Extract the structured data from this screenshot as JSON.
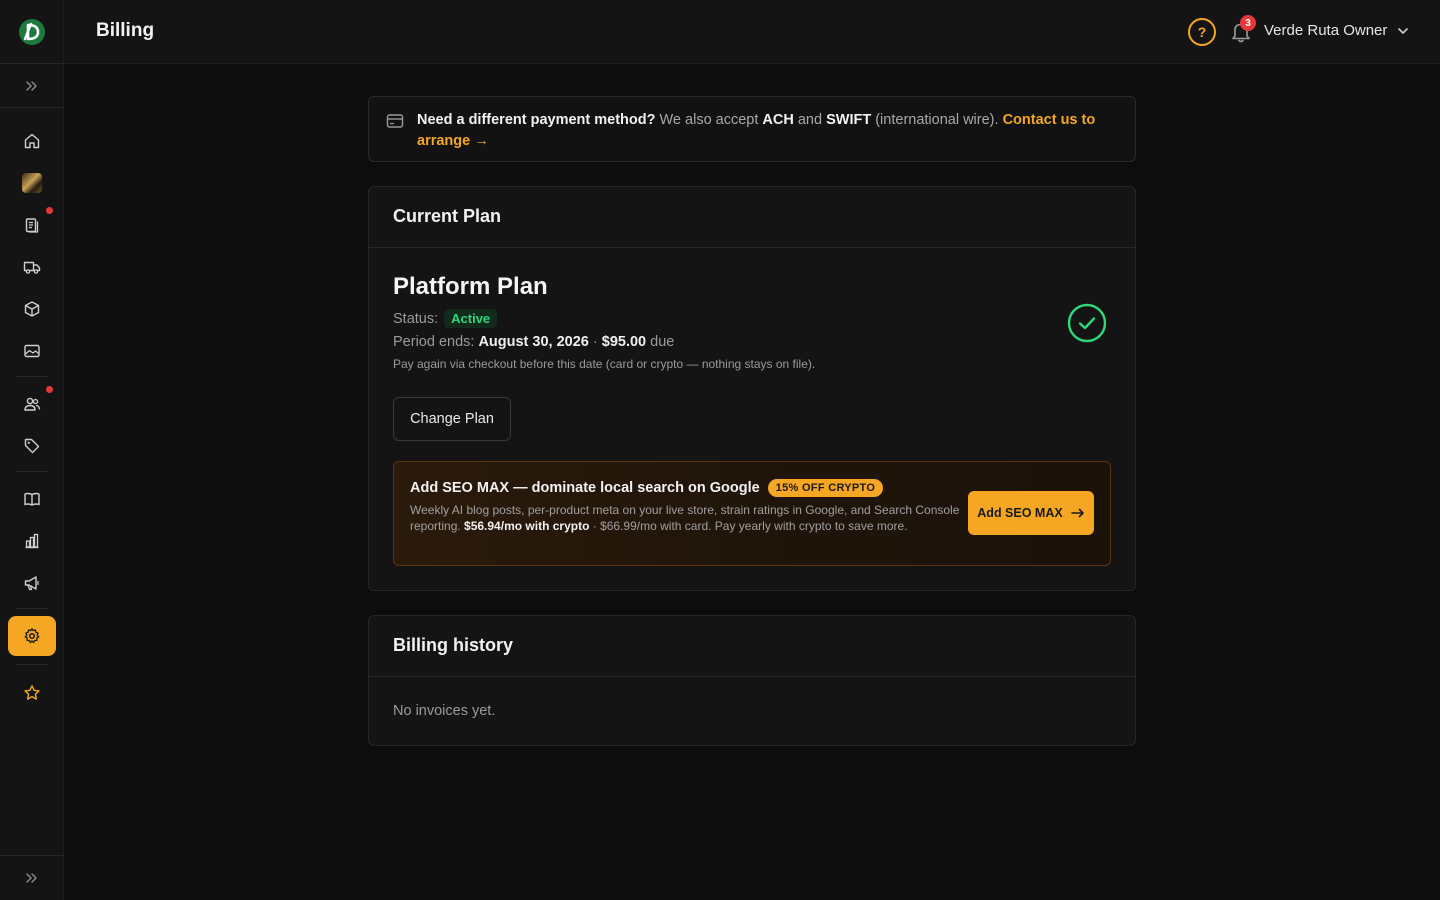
{
  "header": {
    "title": "Billing",
    "notifications_count": "3",
    "user_name": "Verde Ruta Owner"
  },
  "banner": {
    "lead": "Need a different payment method?",
    "text1": " We also accept ",
    "ach": "ACH",
    "and": " and ",
    "swift": "SWIFT",
    "text2": " (international wire).  ",
    "link": "Contact us to arrange →"
  },
  "current_plan": {
    "heading": "Current Plan",
    "plan_name": "Platform Plan",
    "status_label": "Status:",
    "status_value": "Active",
    "period_label": "Period ends: ",
    "period_date": "August 30, 2026",
    "separator": " · ",
    "amount": "$95.00",
    "due": " due",
    "note": "Pay again via checkout before this date (card or crypto — nothing stays on file).",
    "change_button": "Change Plan"
  },
  "promo": {
    "title": "Add SEO MAX — dominate local search on Google",
    "badge": "15% OFF CRYPTO",
    "desc1": "Weekly AI blog posts, per-product meta on your live store, strain ratings in Google, and Search Console reporting. ",
    "crypto_price": "$56.94/mo with crypto",
    "desc2": " · $66.99/mo with card. Pay yearly with crypto to save more.",
    "button": "Add SEO MAX"
  },
  "billing_history": {
    "heading": "Billing history",
    "empty": "No invoices yet."
  },
  "colors": {
    "accent": "#f5a623",
    "success": "#2fd67a",
    "danger": "#e5383b",
    "background": "#0d0d0d"
  },
  "sidebar_icons": [
    "home-icon",
    "product-image-icon",
    "orders-icon",
    "delivery-truck-icon",
    "package-icon",
    "gallery-icon",
    "customers-icon",
    "tag-icon",
    "catalog-book-icon",
    "analytics-icon",
    "marketing-megaphone-icon",
    "settings-gear-icon",
    "star-icon"
  ]
}
